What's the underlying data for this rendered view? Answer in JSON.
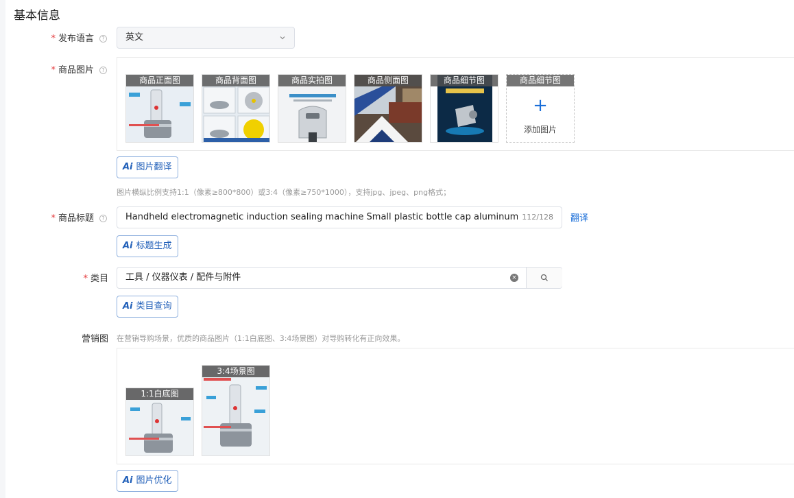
{
  "section": {
    "title": "基本信息"
  },
  "language": {
    "required": "*",
    "label": "发布语言",
    "help": "?",
    "value": "英文"
  },
  "images": {
    "required": "*",
    "label": "商品图片",
    "help": "?",
    "thumbs": [
      "商品正面图",
      "商品背面图",
      "商品实拍图",
      "商品侧面图",
      "商品细节图"
    ],
    "add_slot": {
      "caption": "商品细节图",
      "plus": "+",
      "label": "添加图片"
    },
    "ai_button": {
      "ai": "Ai",
      "label": "图片翻译"
    },
    "hint": "图片横纵比例支持1:1（像素≥800*800）或3:4（像素≥750*1000），支持jpg、jpeg、png格式；"
  },
  "title_field": {
    "required": "*",
    "label": "商品标题",
    "help": "?",
    "value": "Handheld electromagnetic induction sealing machine Small plastic bottle cap aluminum foil",
    "count": "112/128",
    "translate": "翻译",
    "ai_button": {
      "ai": "Ai",
      "label": "标题生成"
    }
  },
  "category": {
    "required": "*",
    "label": "类目",
    "value": "工具 / 仪器仪表 / 配件与附件",
    "clear": "×",
    "ai_button": {
      "ai": "Ai",
      "label": "类目查询"
    }
  },
  "marketing": {
    "label": "营销图",
    "hint": "在营销导购场景，优质的商品图片（1:1白底图、3:4场景图）对导购转化有正向效果。",
    "thumbs": [
      "1:1白底图",
      "3:4场景图"
    ],
    "ai_button": {
      "ai": "Ai",
      "label": "图片优化"
    }
  },
  "colors": {
    "accent": "#1a6ed8",
    "required": "#e4393c",
    "ai_border": "#8fb0de"
  }
}
